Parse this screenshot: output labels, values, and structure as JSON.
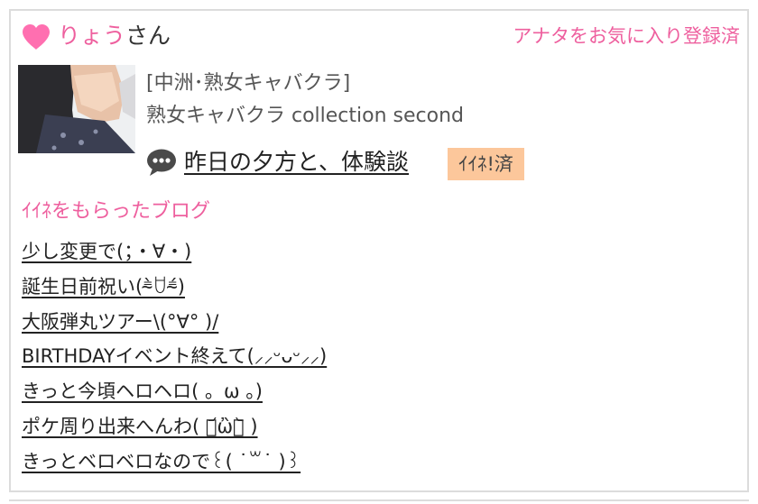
{
  "header": {
    "user_name": "りょう",
    "user_suffix": "さん",
    "favorite_status": "アナタをお気に入り登録済"
  },
  "profile": {
    "shop_category": "[中洲･熟女キャバクラ]",
    "shop_name": "熟女キャバクラ collection second"
  },
  "post": {
    "title": "昨日の夕方と、体験談",
    "iine_badge": "ｲｲﾈ!済"
  },
  "blogs": {
    "section_title": "ｲｲﾈをもらったブログ",
    "items": [
      {
        "label": "少し変更で(；・∀・)"
      },
      {
        "label": "誕生日前祝い(⁼̴̀ꇴ⁼̴́)"
      },
      {
        "label": "大阪弾丸ツアー\\(°∀° )/"
      },
      {
        "label": "BIRTHDAYイベント終えて(⸝⸝ᵕᴗᵕ⸝⸝)"
      },
      {
        "label": "きっと今頃ヘロヘロ( 。ω 。)"
      },
      {
        "label": "ポケ周り出来へんわ( ･᷄ὢ･᷅ )"
      },
      {
        "label": "きっとベロベロなので꒰( ˙꒳​˙ )꒱"
      }
    ]
  },
  "colors": {
    "accent_pink": "#ee5f9e",
    "badge_bg": "#fcc79b",
    "border": "#dcdcdc"
  },
  "icons": {
    "heart": "heart-icon",
    "chat": "chat-bubble-icon"
  }
}
